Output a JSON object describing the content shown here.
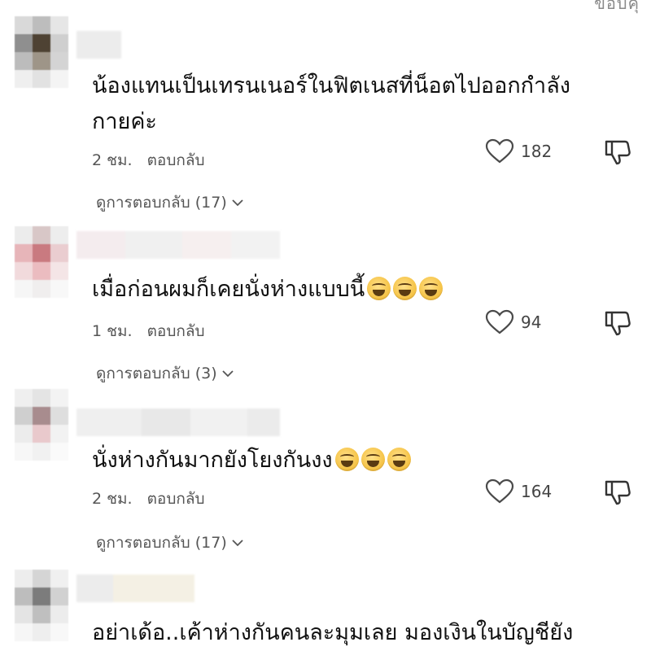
{
  "header_cut": "ขอบคุ",
  "colors": {
    "heart": "#4a4a4a",
    "meta": "#555555"
  },
  "comments": [
    {
      "text_line1": "น้องแทนเป็นเทรนเนอร์ในฟิตเนสที่น็อตไปออกกำลัง",
      "text_line2": "กายค่ะ",
      "time": "2 ชม.",
      "reply_label": "ตอบกลับ",
      "likes": "182",
      "view_replies": "ดูการตอบกลับ (17)"
    },
    {
      "text_line1": "เมื่อก่อนผมก็เคยนั่งห่างแบบนี้",
      "emoji_count": 3,
      "time": "1 ชม.",
      "reply_label": "ตอบกลับ",
      "likes": "94",
      "view_replies": "ดูการตอบกลับ (3)"
    },
    {
      "text_line1": "นั่งห่างกันมากยังโยงกันงง",
      "emoji_count": 3,
      "time": "2 ชม.",
      "reply_label": "ตอบกลับ",
      "likes": "164",
      "view_replies": "ดูการตอบกลับ (17)"
    },
    {
      "text_line1": "อย่าเด้อ..เค้าห่างกันคนละมุมเลย มองเงินในบัญชียัง"
    }
  ]
}
